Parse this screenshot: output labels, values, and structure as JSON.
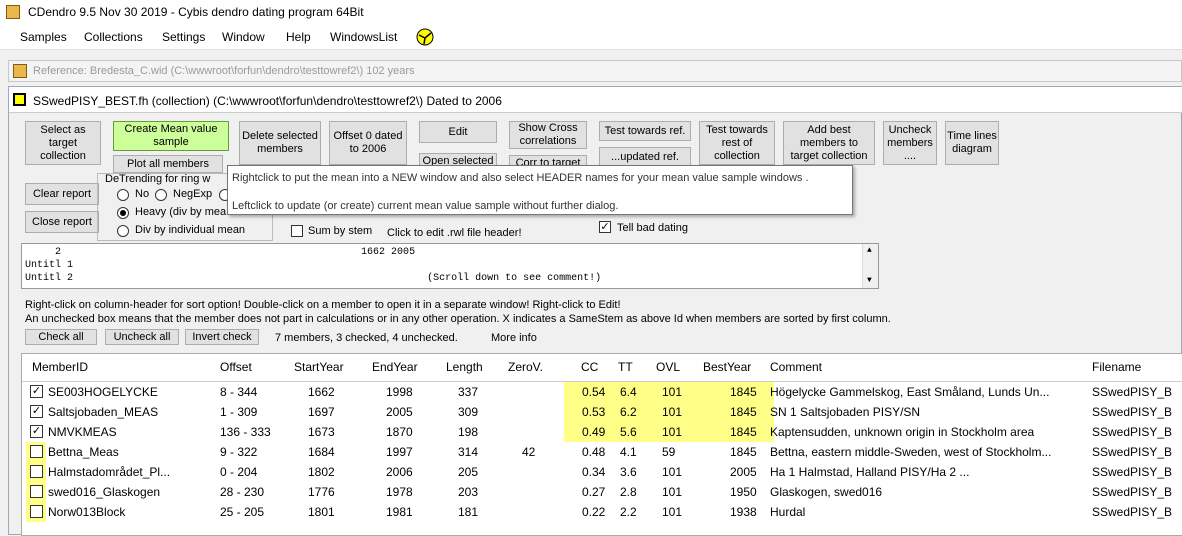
{
  "app": {
    "title": "CDendro 9.5  Nov 30 2019 - Cybis dendro dating program  64Bit",
    "menu": [
      "Samples",
      "Collections",
      "Settings",
      "Window",
      "Help",
      "WindowsList"
    ]
  },
  "reference_window": {
    "title": "Reference: Bredesta_C.wid   (C:\\wwwroot\\forfun\\dendro\\testtowref2\\)  102 years"
  },
  "collection_window": {
    "title": "SSwedPISY_BEST.fh (collection)  (C:\\wwwroot\\forfun\\dendro\\testtowref2\\) Dated to 2006"
  },
  "buttons": {
    "select_target": "Select as target collection",
    "create_mean": "Create Mean value sample",
    "plot_all": "Plot all members",
    "delete_selected": "Delete selected members",
    "offset0": "Offset 0 dated to 2006",
    "edit": "Edit",
    "open_selected": "Open selected",
    "show_cross": "Show Cross correlations",
    "corr_target": "Corr to target",
    "test_ref": "Test towards ref.",
    "updated_ref": "...updated ref.",
    "test_rest": "Test towards rest of collection",
    "add_best": "Add best members to target collection",
    "uncheck_members": "Uncheck members ....",
    "time_lines": "Time lines diagram",
    "clear_report": "Clear report",
    "close_report": "Close report",
    "check_all": "Check all",
    "uncheck_all": "Uncheck all",
    "invert_check": "Invert check"
  },
  "detrending": {
    "title": "DeTrending for ring w",
    "no": "No",
    "negexp": "NegExp",
    "heavy": "Heavy (div by mea",
    "div_individual": "Div by individual mean"
  },
  "options": {
    "sum_by_stem": "Sum by stem",
    "click_edit_rwl": "Click to edit .rwl file header!",
    "tell_bad_dating": "Tell bad dating"
  },
  "tooltip": {
    "line1": "Rightclick to put the mean into a NEW window and also select HEADER names for your mean value sample windows .",
    "line2": "Leftclick to update (or create) current mean value sample without further dialog."
  },
  "rwl_header": {
    "line1": "     2                                                  1662 2005",
    "line2": "Untitl 1",
    "line3": "Untitl 2                                                           (Scroll down to see comment!)"
  },
  "info": {
    "line1": "Right-click on column-header for sort option! Double-click on a member to open it in a separate window! Right-click to Edit!",
    "line2": "An unchecked box means that the member does not part in calculations or in any other operation.  X indicates a SameStem as above Id when members are sorted by first column.",
    "member_count": "7 members, 3 checked, 4 unchecked.",
    "more_info": "More info"
  },
  "table": {
    "headers": [
      "MemberID",
      "Offset",
      "StartYear",
      "EndYear",
      "Length",
      "ZeroV.",
      "CC",
      "TT",
      "OVL",
      "BestYear",
      "Comment",
      "Filename"
    ],
    "rows": [
      {
        "checked": true,
        "id": "SE003HOGELYCKE",
        "offset": "8 -  344",
        "start": "1662",
        "end": "1998",
        "length": "337",
        "zero": "",
        "cc": "0.54",
        "tt": "6.4",
        "ovl": "101",
        "best": "1845",
        "comment": "Högelycke Gammelskog, East Småland, Lunds Un...",
        "file": "SSwedPISY_B"
      },
      {
        "checked": true,
        "id": "Saltsjobaden_MEAS",
        "offset": "1 -  309",
        "start": "1697",
        "end": "2005",
        "length": "309",
        "zero": "",
        "cc": "0.53",
        "tt": "6.2",
        "ovl": "101",
        "best": "1845",
        "comment": "SN    1 Saltsjobaden                         PISY/SN",
        "file": "SSwedPISY_B"
      },
      {
        "checked": true,
        "id": "NMVKMEAS",
        "offset": "136 -  333",
        "start": "1673",
        "end": "1870",
        "length": "198",
        "zero": "",
        "cc": "0.49",
        "tt": "5.6",
        "ovl": "101",
        "best": "1845",
        "comment": "Kaptensudden, unknown origin in Stockholm area",
        "file": "SSwedPISY_B"
      },
      {
        "checked": false,
        "id": "Bettna_Meas",
        "offset": "9 -  322",
        "start": "1684",
        "end": "1997",
        "length": "314",
        "zero": "42",
        "cc": "0.48",
        "tt": "4.1",
        "ovl": "59",
        "best": "1845",
        "comment": "Bettna, eastern middle-Sweden, west of Stockholm...",
        "file": "SSwedPISY_B"
      },
      {
        "checked": false,
        "id": "Halmstadområdet_Pl...",
        "offset": "0 -  204",
        "start": "1802",
        "end": "2006",
        "length": "205",
        "zero": "",
        "cc": "0.34",
        "tt": "3.6",
        "ovl": "101",
        "best": "2005",
        "comment": "Ha    1 Halmstad, Halland              PISY/Ha     2 ...",
        "file": "SSwedPISY_B"
      },
      {
        "checked": false,
        "id": "swed016_Glaskogen",
        "offset": "28 -  230",
        "start": "1776",
        "end": "1978",
        "length": "203",
        "zero": "",
        "cc": "0.27",
        "tt": "2.8",
        "ovl": "101",
        "best": "1950",
        "comment": "Glaskogen, swed016",
        "file": "SSwedPISY_B"
      },
      {
        "checked": false,
        "id": "Norw013Block",
        "offset": "25 -  205",
        "start": "1801",
        "end": "1981",
        "length": "181",
        "zero": "",
        "cc": "0.22",
        "tt": "2.2",
        "ovl": "101",
        "best": "1938",
        "comment": "Hurdal",
        "file": "SSwedPISY_B"
      }
    ]
  },
  "colors": {
    "highlight": "#ffff88",
    "green_button": "#ccff99"
  }
}
